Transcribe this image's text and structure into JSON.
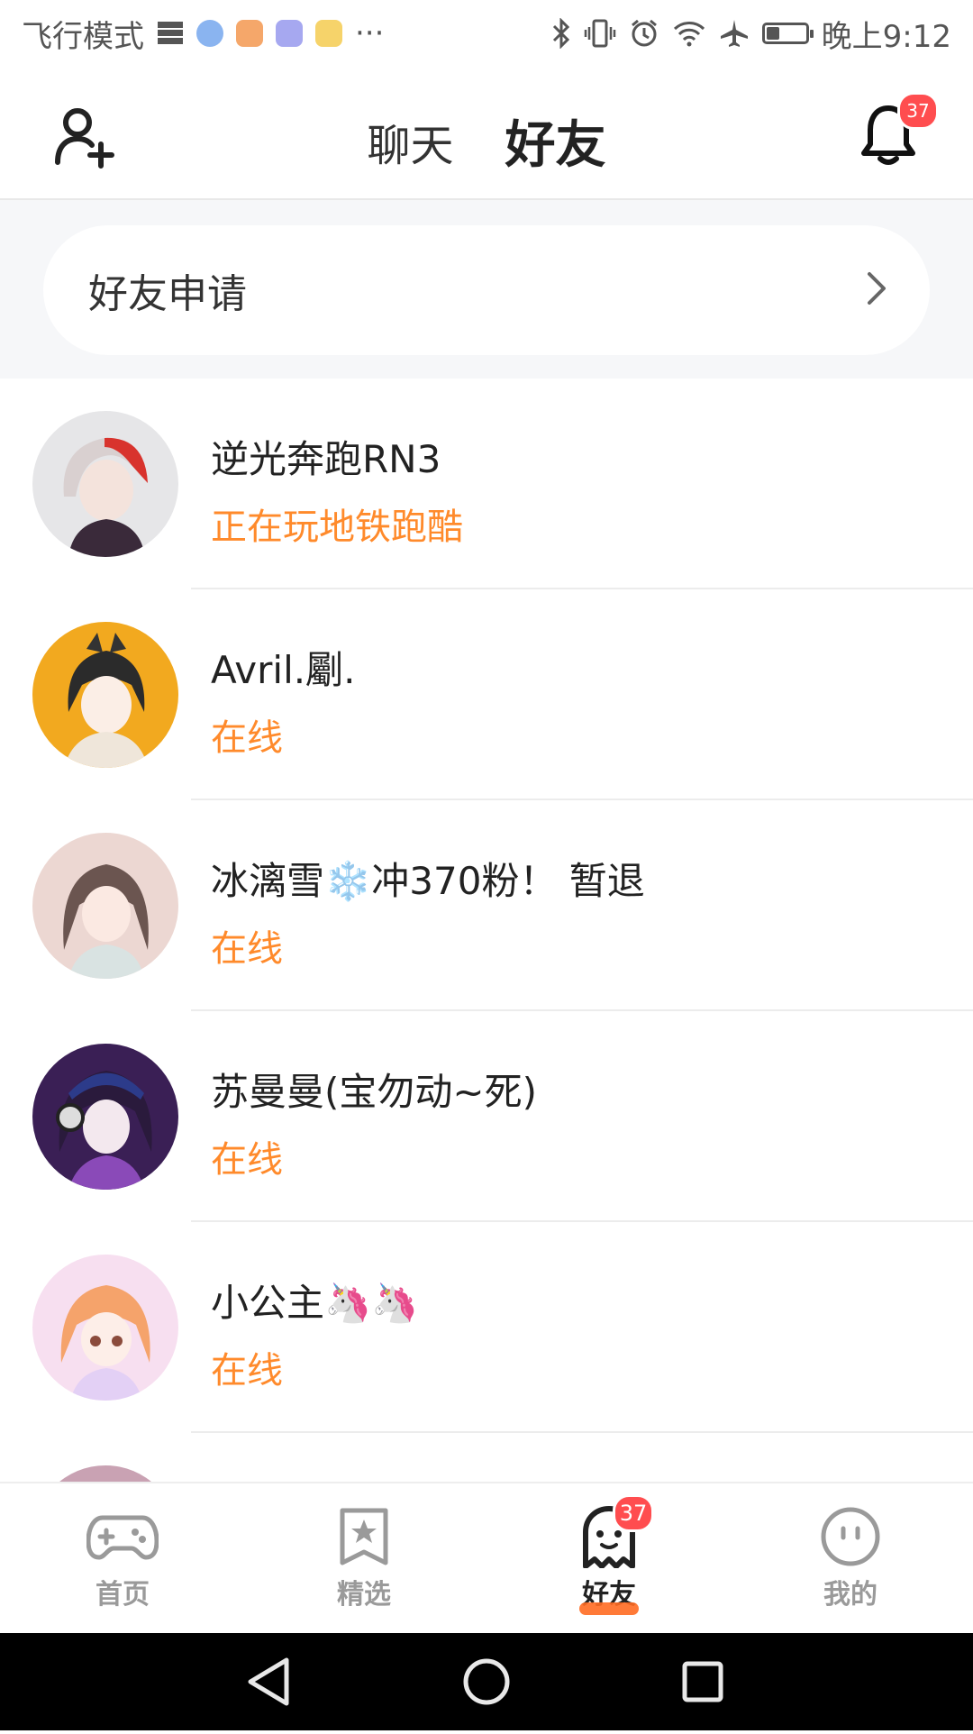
{
  "status_bar": {
    "left_text": "飞行模式",
    "more": "···",
    "time": "晚上9:12",
    "icons": [
      "storage-icon",
      "browser-app-icon",
      "video-app-icon",
      "music-app-icon",
      "gallery-app-icon",
      "bluetooth-icon",
      "vibrate-icon",
      "alarm-icon",
      "wifi-icon",
      "airplane-icon",
      "battery-icon"
    ]
  },
  "header": {
    "tabs": [
      {
        "label": "聊天",
        "active": false
      },
      {
        "label": "好友",
        "active": true
      }
    ],
    "notification_count": "37",
    "accent_color": "#ff5a1f"
  },
  "friend_requests": {
    "label": "好友申请"
  },
  "friends": [
    {
      "name": "逆光奔跑RN3",
      "status": "正在玩地铁跑酷"
    },
    {
      "name": "Avril.劚.",
      "status": "在线"
    },
    {
      "name": "冰漓雪❄️冲370粉！ 暂退",
      "status": "在线"
    },
    {
      "name": "苏曼曼(宝勿动~死)",
      "status": "在线"
    },
    {
      "name": "小公主🦄🦄",
      "status": "在线"
    }
  ],
  "bottom_nav": {
    "items": [
      {
        "label": "首页",
        "icon": "gamepad-icon",
        "active": false
      },
      {
        "label": "精选",
        "icon": "star-bookmark-icon",
        "active": false
      },
      {
        "label": "好友",
        "icon": "ghost-icon",
        "active": true,
        "badge": "37"
      },
      {
        "label": "我的",
        "icon": "face-icon",
        "active": false
      }
    ]
  },
  "colors": {
    "status_text": "#ff8a2b",
    "badge": "#ff4d4f",
    "background_section": "#f6f7f9"
  }
}
